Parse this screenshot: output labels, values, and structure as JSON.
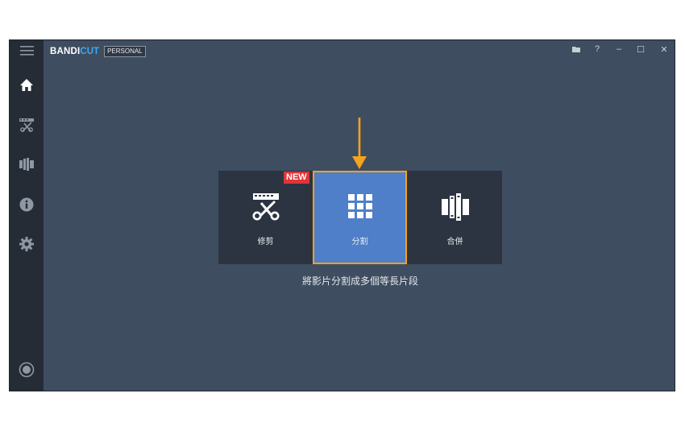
{
  "app": {
    "brand_main": "BANDI",
    "brand_accent": "CUT",
    "edition": "PERSONAL"
  },
  "sidebar": {
    "items": [
      {
        "name": "menu",
        "icon": "hamburger-icon"
      },
      {
        "name": "home",
        "icon": "home-icon"
      },
      {
        "name": "cut",
        "icon": "scissors-film-icon"
      },
      {
        "name": "join",
        "icon": "film-strips-icon"
      },
      {
        "name": "info",
        "icon": "info-icon"
      },
      {
        "name": "settings",
        "icon": "gear-icon"
      },
      {
        "name": "record",
        "icon": "record-icon"
      }
    ]
  },
  "window_controls": {
    "open": "folder-icon",
    "help": "?",
    "minimize": "–",
    "maximize": "☐",
    "close": "✕"
  },
  "modes": [
    {
      "label": "修剪",
      "badge": "NEW",
      "icon": "scissors-film-icon"
    },
    {
      "label": "分割",
      "icon": "grid-split-icon",
      "selected": true
    },
    {
      "label": "合併",
      "icon": "film-join-icon"
    }
  ],
  "description": "將影片分割成多個等長片段",
  "colors": {
    "background": "#3f4d60",
    "sidebar": "#262c35",
    "panel": "#2c3441",
    "selected_tile": "#4f7fc8",
    "highlight": "#f5a31a",
    "badge": "#e0353a",
    "brand_accent": "#3da8f5"
  }
}
